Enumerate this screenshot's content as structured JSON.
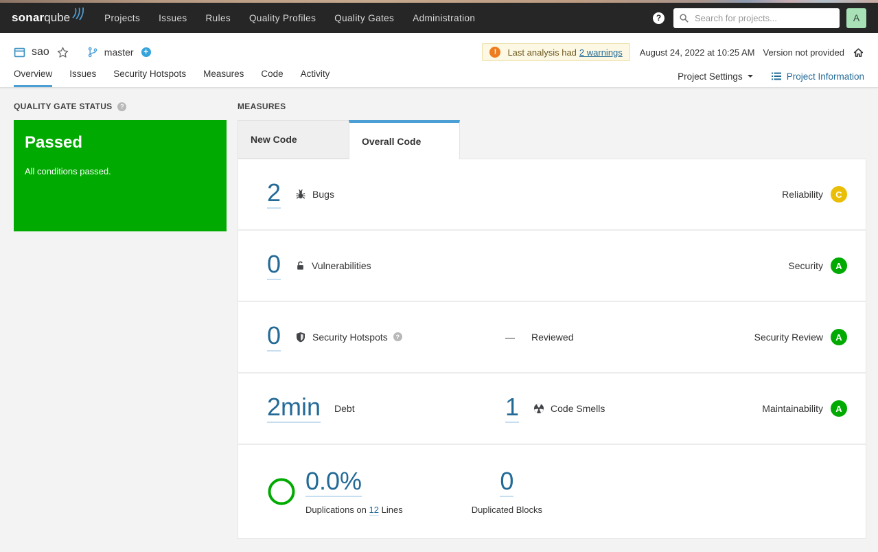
{
  "topbar": {
    "logo_sonar": "sonar",
    "logo_qube": "qube",
    "nav": [
      "Projects",
      "Issues",
      "Rules",
      "Quality Profiles",
      "Quality Gates",
      "Administration"
    ],
    "help_symbol": "?",
    "search_placeholder": "Search for projects...",
    "avatar_letter": "A"
  },
  "header": {
    "project_name": "sao",
    "branch_name": "master",
    "plus_symbol": "+",
    "warning": {
      "icon_symbol": "!",
      "text": "Last analysis had",
      "link": "2 warnings"
    },
    "analysis_date": "August 24, 2022 at 10:25 AM",
    "version_text": "Version not provided",
    "tabs": [
      "Overview",
      "Issues",
      "Security Hotspots",
      "Measures",
      "Code",
      "Activity"
    ],
    "project_settings_label": "Project Settings",
    "project_information_label": "Project Information"
  },
  "quality_gate": {
    "section_title": "QUALITY GATE STATUS",
    "help_symbol": "?",
    "status": "Passed",
    "message": "All conditions passed.",
    "passed_color": "#00aa00"
  },
  "measures": {
    "section_title": "MEASURES",
    "tabs": {
      "new_code": "New Code",
      "overall_code": "Overall Code"
    },
    "rows": {
      "bugs": {
        "value": "2",
        "label": "Bugs",
        "domain": "Reliability",
        "rating": "C",
        "rating_color": "#eabe06"
      },
      "vulnerabilities": {
        "value": "0",
        "label": "Vulnerabilities",
        "domain": "Security",
        "rating": "A",
        "rating_color": "#00aa00"
      },
      "hotspots": {
        "value": "0",
        "label": "Security Hotspots",
        "help_symbol": "?",
        "reviewed_dash": "—",
        "reviewed_label": "Reviewed",
        "domain": "Security Review",
        "rating": "A",
        "rating_color": "#00aa00"
      },
      "maintainability": {
        "debt_value": "2min",
        "debt_label": "Debt",
        "smells_value": "1",
        "smells_label": "Code Smells",
        "domain": "Maintainability",
        "rating": "A",
        "rating_color": "#00aa00"
      },
      "duplications": {
        "value": "0.0%",
        "label_prefix": "Duplications on",
        "lines_value": "12",
        "label_suffix": "Lines",
        "blocks_value": "0",
        "blocks_label": "Duplicated Blocks"
      }
    }
  },
  "colors": {
    "link_blue": "#236a97",
    "tab_active_border": "#4b9fd5",
    "rating_a_green": "#00aa00",
    "rating_c_yellow": "#eabe06",
    "warning_orange": "#ed7d20",
    "navbar_dark": "#262626"
  }
}
